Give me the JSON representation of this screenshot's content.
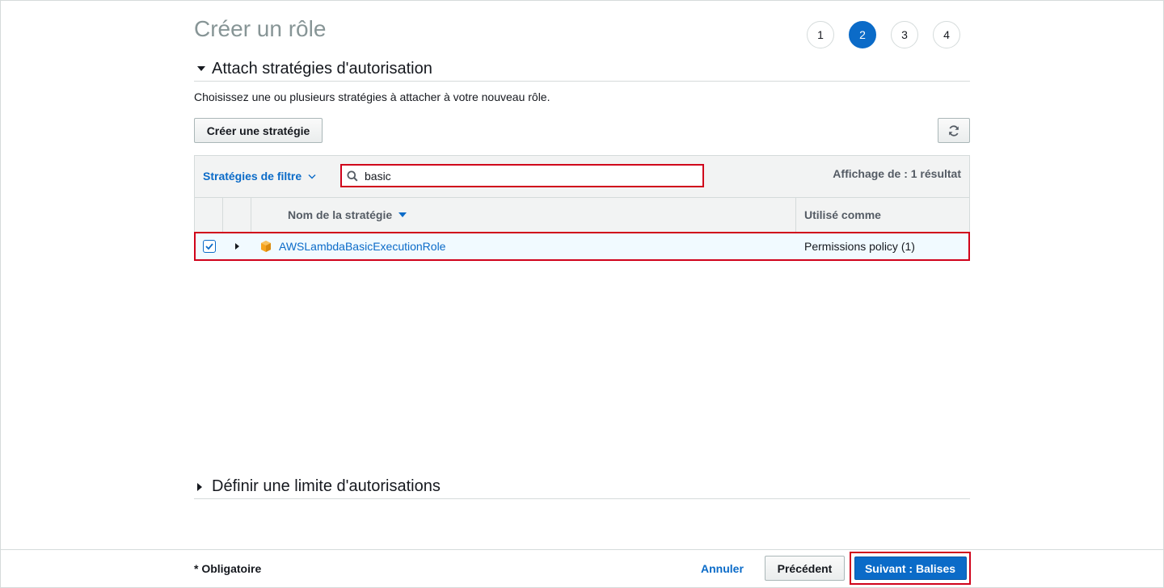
{
  "page": {
    "title": "Créer un rôle"
  },
  "steps": [
    "1",
    "2",
    "3",
    "4"
  ],
  "attach_section": {
    "title": "Attach stratégies d'autorisation",
    "description": "Choisissez une ou plusieurs stratégies à attacher à votre nouveau rôle.",
    "create_button": "Créer une stratégie",
    "filter_label": "Stratégies de filtre",
    "search_value": "basic",
    "result_count": "Affichage de : 1 résultat",
    "columns": {
      "name": "Nom de la stratégie",
      "used_as": "Utilisé comme"
    },
    "rows": [
      {
        "name": "AWSLambdaBasicExecutionRole",
        "used_as": "Permissions policy (1)",
        "checked": true
      }
    ]
  },
  "boundary_section": {
    "title": "Définir une limite d'autorisations"
  },
  "footer": {
    "required_note": "* Obligatoire",
    "cancel": "Annuler",
    "previous": "Précédent",
    "next": "Suivant : Balises"
  },
  "colors": {
    "accent": "#0b6bc8",
    "highlight": "#d0021b",
    "policy_icon": "#f7a41d"
  },
  "icons": [
    "search-icon",
    "refresh-icon",
    "chevron-down-icon",
    "aws-managed-policy-icon",
    "checkmark-icon"
  ]
}
